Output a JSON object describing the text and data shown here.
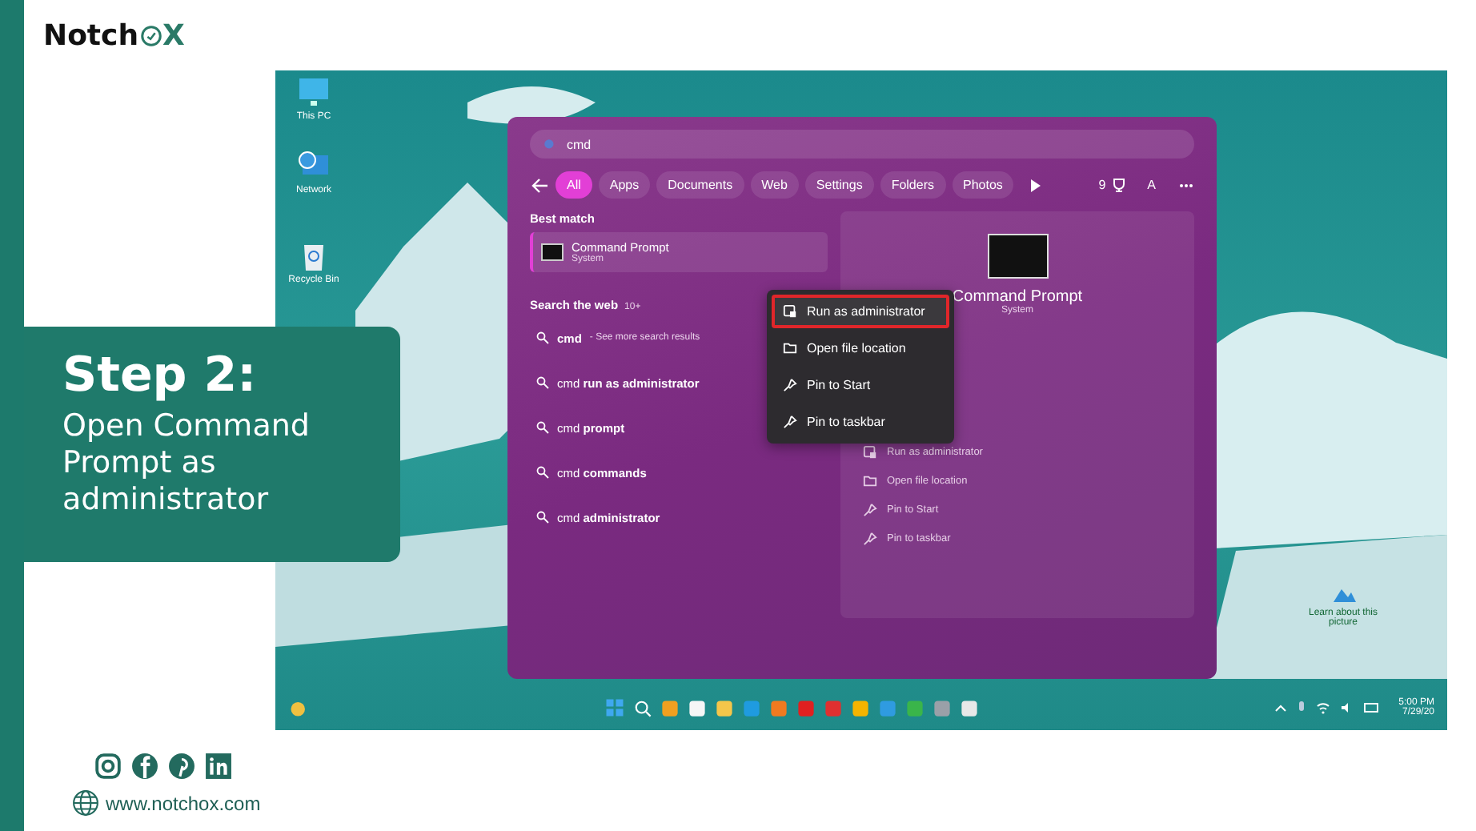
{
  "logo": {
    "text_start": "Notch",
    "text_end": "X"
  },
  "step": {
    "title": "Step 2:",
    "description": "Open Command Prompt as administrator"
  },
  "desktop": {
    "icons": [
      {
        "label": "This PC",
        "kind": "pc"
      },
      {
        "label": "Network",
        "kind": "network"
      },
      {
        "label": "Recycle Bin",
        "kind": "bin"
      }
    ],
    "spotlight": {
      "label": "Learn about this picture"
    }
  },
  "search_panel": {
    "search": {
      "value": "cmd"
    },
    "filters": [
      {
        "label": "All",
        "selected": true
      },
      {
        "label": "Apps",
        "selected": false
      },
      {
        "label": "Documents",
        "selected": false
      },
      {
        "label": "Web",
        "selected": false
      },
      {
        "label": "Settings",
        "selected": false
      },
      {
        "label": "Folders",
        "selected": false
      },
      {
        "label": "Photos",
        "selected": false
      }
    ],
    "points": "9",
    "account": "A",
    "best_match": {
      "heading": "Best match",
      "name": "Command Prompt",
      "type": "System"
    },
    "web": {
      "heading": "Search the web",
      "count": "10+",
      "results": [
        {
          "query": "cmd",
          "hint": "- See more search results"
        },
        {
          "query": "cmd **run as administrator**"
        },
        {
          "query": "cmd **prompt**"
        },
        {
          "query": "cmd **commands**"
        },
        {
          "query": "cmd **administrator**"
        }
      ]
    },
    "details": {
      "name": "Command Prompt",
      "type": "System",
      "actions": [
        {
          "label": "Run as administrator",
          "kind": "admin"
        },
        {
          "label": "Open file location",
          "kind": "folder"
        },
        {
          "label": "Pin to Start",
          "kind": "pin"
        },
        {
          "label": "Pin to taskbar",
          "kind": "pin"
        }
      ]
    }
  },
  "context_menu": [
    {
      "label": "Run as administrator",
      "kind": "admin",
      "selected": true
    },
    {
      "label": "Open file location",
      "kind": "folder",
      "selected": false
    },
    {
      "label": "Pin to Start",
      "kind": "pin",
      "selected": false
    },
    {
      "label": "Pin to taskbar",
      "kind": "pin",
      "selected": false
    }
  ],
  "taskbar": {
    "time": "5:00 PM",
    "date": "7/29/20"
  },
  "footer": {
    "website": "www.notchox.com"
  }
}
